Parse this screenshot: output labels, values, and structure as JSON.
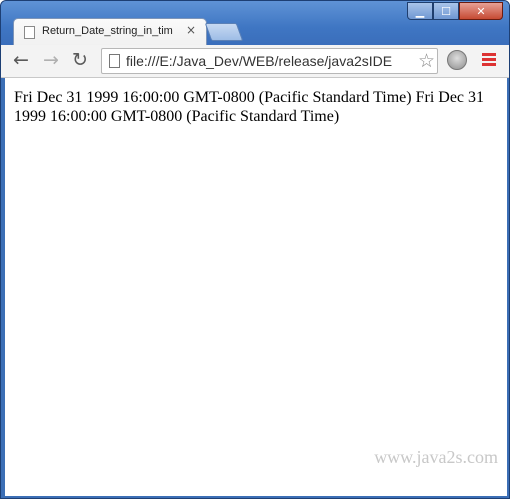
{
  "window": {
    "controls": {
      "minimize": "▁",
      "maximize": "☐",
      "close": "✕"
    }
  },
  "tab": {
    "title": "Return_Date_string_in_tim",
    "close_label": "×"
  },
  "toolbar": {
    "back": "←",
    "forward": "→",
    "reload": "↻",
    "url": "file:///E:/Java_Dev/WEB/release/java2sIDE",
    "bookmark_star": "☆"
  },
  "page": {
    "text": "Fri Dec 31 1999 16:00:00 GMT-0800 (Pacific Standard Time) Fri Dec 31 1999 16:00:00 GMT-0800 (Pacific Standard Time)",
    "watermark": "www.java2s.com"
  }
}
